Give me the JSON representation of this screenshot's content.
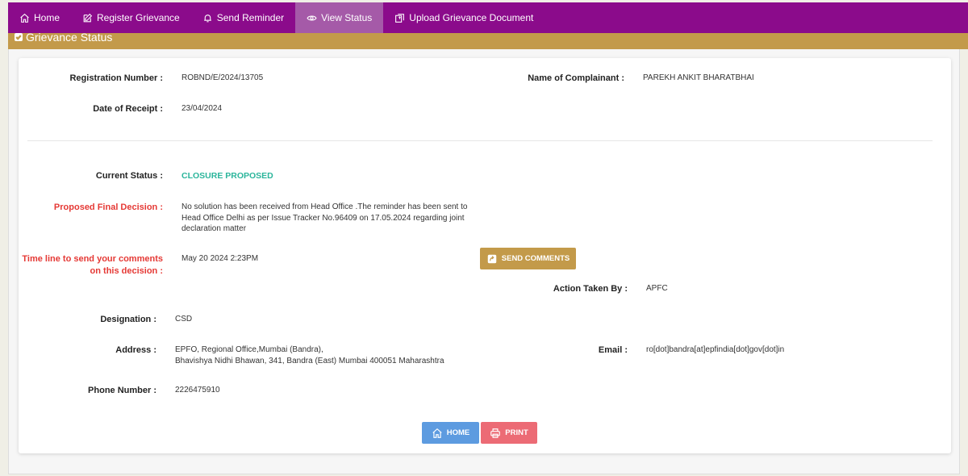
{
  "nav": {
    "items": [
      {
        "label": "Home",
        "icon": "home-icon"
      },
      {
        "label": "Register Grievance",
        "icon": "edit-icon"
      },
      {
        "label": "Send Reminder",
        "icon": "bell-icon"
      },
      {
        "label": "View Status",
        "icon": "eye-icon",
        "active": true
      },
      {
        "label": "Upload Grievance Document",
        "icon": "upload-icon"
      }
    ]
  },
  "panel": {
    "title": "Grievance Status"
  },
  "details": {
    "reg_label": "Registration Number :",
    "reg_value": "ROBND/E/2024/13705",
    "name_label": "Name of Complainant :",
    "name_value": "PAREKH ANKIT BHARATBHAI",
    "date_label": "Date of Receipt :",
    "date_value": "23/04/2024",
    "status_label": "Current Status :",
    "status_value": "CLOSURE PROPOSED",
    "decision_label": "Proposed Final Decision :",
    "decision_value": "No solution has been received from Head Office .The reminder has been sent to Head Office Delhi as per Issue Tracker No.96409 on 17.05.2024 regarding joint declaration matter",
    "timeline_label": "Time line to send your comments on this decision :",
    "timeline_value": "May 20 2024 2:23PM",
    "action_label": "Action Taken By :",
    "action_value": "APFC",
    "designation_label": "Designation :",
    "designation_value": "CSD",
    "address_label": "Address :",
    "address_line1": "EPFO, Regional Office,Mumbai (Bandra),",
    "address_line2": "Bhavishya Nidhi Bhawan, 341, Bandra (East) Mumbai 400051 Maharashtra",
    "email_label": "Email :",
    "email_value": "ro[dot]bandra[at]epfindia[dot]gov[dot]in",
    "phone_label": "Phone Number :",
    "phone_value": "2226475910"
  },
  "buttons": {
    "send_comments": "SEND COMMENTS",
    "home": "HOME",
    "print": "PRINT"
  },
  "colors": {
    "nav_bg": "#8b0b8b",
    "nav_active": "#a55aa8",
    "panel_header": "#c39a4a",
    "status_green": "#2bb59b",
    "label_red": "#e53935",
    "home_btn": "#5d9be0",
    "print_btn": "#ec6b75"
  }
}
